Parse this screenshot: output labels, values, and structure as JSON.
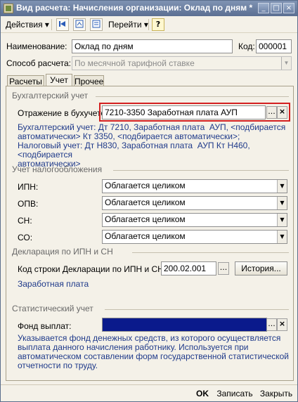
{
  "window": {
    "title": "Вид расчета: Начисления организации: Оклад по дням *",
    "min_label": "_",
    "max_label": "□",
    "close_label": "×"
  },
  "toolbar": {
    "actions_label": "Действия ▾",
    "goto_label": "Перейти ▾",
    "help_label": "?"
  },
  "header": {
    "name_label": "Наименование:",
    "name_value": "Оклад по дням",
    "code_label": "Код:",
    "code_value": "000001",
    "method_label": "Способ расчета:",
    "method_value": "По месячной тарифной ставке"
  },
  "tabs": [
    {
      "label": "Расчеты",
      "active": false
    },
    {
      "label": "Учет",
      "active": true
    },
    {
      "label": "Прочее",
      "active": false
    }
  ],
  "accounting": {
    "section_title": "Бухгалтерский учет",
    "reflection_label": "Отражение в бухучете:",
    "reflection_value": "7210-3350 Заработная плата АУП",
    "dots": "...",
    "clear": "×",
    "details": "Бухгалтерский учет: Дт 7210, Заработная плата  АУП, <подбирается\nавтоматически> Кт 3350, <подбирается автоматически>;\nНалоговый учет: Дт Н830, Заработная плата  АУП Кт Н460, <подбирается\nавтоматически>"
  },
  "taxation": {
    "section_title": "Учет налогообложения",
    "rows": [
      {
        "label": "ИПН:",
        "value": "Облагается целиком"
      },
      {
        "label": "ОПВ:",
        "value": "Облагается целиком"
      },
      {
        "label": "СН:",
        "value": "Облагается целиком"
      },
      {
        "label": "СО:",
        "value": "Облагается целиком"
      }
    ]
  },
  "declaration": {
    "section_title": "Декларация по ИПН и СН",
    "code_label": "Код строки Декларации по ИПН и СН:",
    "code_value": "200.02.001",
    "dots": "...",
    "history_label": "История...",
    "link_text": "Заработная плата"
  },
  "statistics": {
    "section_title": "Статистический учет",
    "fund_label": "Фонд выплат:",
    "fund_value": "",
    "dots": "...",
    "clear": "×",
    "hint": "Указывается фонд денежных средств, из которого осуществляется\nвыплата данного начисления работнику. Используется при\nавтоматическом составлении форм государственной статистической\nотчетности по труду."
  },
  "footer": {
    "ok_label": "OK",
    "save_label": "Записать",
    "close_label": "Закрыть"
  },
  "colors": {
    "title_bar": "#6b7fa2",
    "highlight_border": "#d42020",
    "link_blue": "#1f3a8a",
    "selected_fill": "#0a1a8c"
  }
}
